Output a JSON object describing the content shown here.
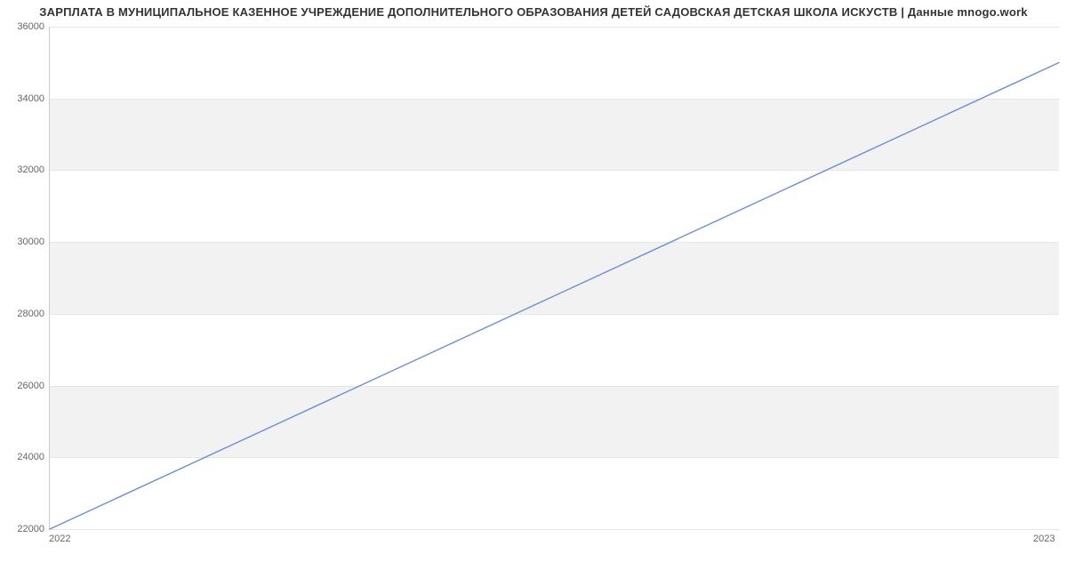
{
  "chart_data": {
    "type": "line",
    "title": "ЗАРПЛАТА В МУНИЦИПАЛЬНОЕ КАЗЕННОЕ УЧРЕЖДЕНИЕ ДОПОЛНИТЕЛЬНОГО ОБРАЗОВАНИЯ ДЕТЕЙ САДОВСКАЯ ДЕТСКАЯ ШКОЛА ИСКУСТВ | Данные mnogo.work",
    "x": [
      2022,
      2023
    ],
    "values": [
      22000,
      35000
    ],
    "x_ticks": [
      2022,
      2023
    ],
    "y_ticks": [
      22000,
      24000,
      26000,
      28000,
      30000,
      32000,
      34000,
      36000
    ],
    "ylim": [
      22000,
      36000
    ],
    "xlabel": "",
    "ylabel": "",
    "line_color": "#6b8fd6"
  }
}
